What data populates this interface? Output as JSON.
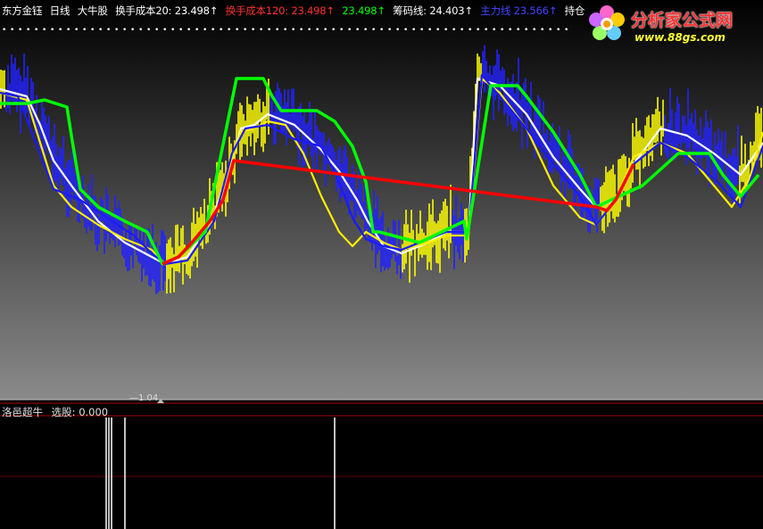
{
  "header": {
    "stock_name": "东方金钰",
    "period": "日线",
    "formula": "大牛股",
    "cost20_label": "换手成本20:",
    "cost20_value": "23.498",
    "cost120_label": "换手成本120:",
    "cost120_value": "23.498",
    "green_value": "23.498",
    "chip_label": "筹码线:",
    "chip_value": "24.403",
    "blue_label": "主力线",
    "blue_value": "23.566",
    "hold_label": "持仓"
  },
  "low_marker": "1.04",
  "sub_header": {
    "indicator_name": "洛邑超牛",
    "select_label": "选股:",
    "select_value": "0.000"
  },
  "logo": {
    "title": "分析家公式网",
    "url": "www.88gs.com"
  },
  "colors": {
    "background": "#000000",
    "gradient_bottom": "#8a8a8a",
    "price_yellow": "#ffff00",
    "price_blue": "#2222ff",
    "line_white": "#ffffff",
    "line_yellow": "#ffee00",
    "line_blue": "#1a1aff",
    "line_green": "#00ff00",
    "line_red": "#ff0000",
    "divider": "#aa0000"
  },
  "chart_data": [
    {
      "type": "line",
      "panel": "main",
      "y_scale": "price",
      "series": [
        {
          "color": "#ffffff",
          "points": [
            [
              0,
              0.15
            ],
            [
              30,
              0.17
            ],
            [
              45,
              0.25
            ],
            [
              60,
              0.35
            ],
            [
              80,
              0.42
            ],
            [
              110,
              0.52
            ],
            [
              140,
              0.58
            ],
            [
              170,
              0.62
            ],
            [
              185,
              0.64
            ],
            [
              210,
              0.62
            ],
            [
              240,
              0.5
            ],
            [
              260,
              0.35
            ],
            [
              270,
              0.26
            ],
            [
              285,
              0.25
            ],
            [
              300,
              0.22
            ],
            [
              330,
              0.25
            ],
            [
              360,
              0.32
            ],
            [
              380,
              0.38
            ],
            [
              400,
              0.46
            ],
            [
              412,
              0.52
            ],
            [
              430,
              0.59
            ],
            [
              450,
              0.61
            ],
            [
              480,
              0.58
            ],
            [
              500,
              0.55
            ],
            [
              520,
              0.55
            ],
            [
              525,
              0.55
            ],
            [
              535,
              0.12
            ],
            [
              560,
              0.14
            ],
            [
              590,
              0.22
            ],
            [
              620,
              0.34
            ],
            [
              650,
              0.43
            ],
            [
              668,
              0.48
            ],
            [
              690,
              0.46
            ],
            [
              710,
              0.36
            ],
            [
              740,
              0.26
            ],
            [
              770,
              0.28
            ],
            [
              800,
              0.33
            ],
            [
              830,
              0.39
            ],
            [
              855,
              0.3
            ]
          ]
        },
        {
          "color": "#ffee00",
          "points": [
            [
              0,
              0.16
            ],
            [
              30,
              0.18
            ],
            [
              45,
              0.3
            ],
            [
              60,
              0.42
            ],
            [
              80,
              0.48
            ],
            [
              110,
              0.53
            ],
            [
              140,
              0.57
            ],
            [
              170,
              0.6
            ],
            [
              185,
              0.64
            ],
            [
              210,
              0.63
            ],
            [
              240,
              0.52
            ],
            [
              260,
              0.35
            ],
            [
              270,
              0.27
            ],
            [
              285,
              0.26
            ],
            [
              300,
              0.24
            ],
            [
              320,
              0.25
            ],
            [
              340,
              0.33
            ],
            [
              360,
              0.45
            ],
            [
              380,
              0.55
            ],
            [
              395,
              0.59
            ],
            [
              410,
              0.55
            ],
            [
              430,
              0.58
            ],
            [
              450,
              0.6
            ],
            [
              480,
              0.58
            ],
            [
              500,
              0.56
            ],
            [
              520,
              0.56
            ],
            [
              525,
              0.56
            ],
            [
              540,
              0.12
            ],
            [
              560,
              0.16
            ],
            [
              590,
              0.26
            ],
            [
              620,
              0.42
            ],
            [
              650,
              0.51
            ],
            [
              668,
              0.53
            ],
            [
              690,
              0.46
            ],
            [
              710,
              0.34
            ],
            [
              740,
              0.3
            ],
            [
              770,
              0.33
            ],
            [
              800,
              0.42
            ],
            [
              820,
              0.48
            ],
            [
              840,
              0.4
            ],
            [
              855,
              0.27
            ]
          ]
        },
        {
          "color": "#1a1aff",
          "points": [
            [
              0,
              0.16
            ],
            [
              20,
              0.17
            ],
            [
              40,
              0.3
            ],
            [
              60,
              0.43
            ],
            [
              90,
              0.46
            ],
            [
              120,
              0.51
            ],
            [
              150,
              0.56
            ],
            [
              170,
              0.61
            ],
            [
              185,
              0.64
            ],
            [
              210,
              0.63
            ],
            [
              240,
              0.52
            ],
            [
              260,
              0.33
            ],
            [
              275,
              0.26
            ],
            [
              300,
              0.25
            ],
            [
              330,
              0.29
            ],
            [
              360,
              0.31
            ],
            [
              380,
              0.41
            ],
            [
              395,
              0.51
            ],
            [
              410,
              0.57
            ],
            [
              430,
              0.59
            ],
            [
              450,
              0.6
            ],
            [
              480,
              0.57
            ],
            [
              500,
              0.55
            ],
            [
              520,
              0.55
            ],
            [
              525,
              0.55
            ],
            [
              540,
              0.11
            ],
            [
              560,
              0.17
            ],
            [
              590,
              0.26
            ],
            [
              620,
              0.36
            ],
            [
              650,
              0.45
            ],
            [
              668,
              0.53
            ],
            [
              690,
              0.46
            ],
            [
              710,
              0.36
            ],
            [
              740,
              0.3
            ],
            [
              770,
              0.34
            ],
            [
              800,
              0.4
            ],
            [
              830,
              0.48
            ],
            [
              855,
              0.31
            ]
          ]
        },
        {
          "color": "#00ff00",
          "points": [
            [
              0,
              0.19
            ],
            [
              30,
              0.19
            ],
            [
              50,
              0.18
            ],
            [
              75,
              0.2
            ],
            [
              80,
              0.28
            ],
            [
              90,
              0.43
            ],
            [
              110,
              0.48
            ],
            [
              140,
              0.52
            ],
            [
              165,
              0.55
            ],
            [
              182,
              0.64
            ],
            [
              200,
              0.62
            ],
            [
              230,
              0.55
            ],
            [
              265,
              0.12
            ],
            [
              295,
              0.12
            ],
            [
              305,
              0.17
            ],
            [
              315,
              0.21
            ],
            [
              355,
              0.21
            ],
            [
              375,
              0.24
            ],
            [
              395,
              0.31
            ],
            [
              410,
              0.41
            ],
            [
              418,
              0.55
            ],
            [
              425,
              0.55
            ],
            [
              470,
              0.58
            ],
            [
              520,
              0.52
            ],
            [
              523,
              0.57
            ],
            [
              550,
              0.14
            ],
            [
              580,
              0.14
            ],
            [
              590,
              0.17
            ],
            [
              620,
              0.27
            ],
            [
              650,
              0.39
            ],
            [
              668,
              0.48
            ],
            [
              720,
              0.42
            ],
            [
              760,
              0.33
            ],
            [
              795,
              0.33
            ],
            [
              810,
              0.39
            ],
            [
              830,
              0.45
            ],
            [
              850,
              0.39
            ]
          ]
        },
        {
          "color": "#ff0000",
          "points": [
            [
              182,
              0.64
            ],
            [
              200,
              0.62
            ],
            [
              215,
              0.58
            ],
            [
              235,
              0.52
            ],
            [
              250,
              0.46
            ],
            [
              262,
              0.35
            ],
            [
              668,
              0.48
            ],
            [
              680,
              0.49
            ],
            [
              690,
              0.46
            ],
            [
              700,
              0.41
            ],
            [
              710,
              0.36
            ]
          ]
        }
      ]
    },
    {
      "type": "bar",
      "panel": "sub",
      "name": "选股",
      "ylim": [
        0,
        1
      ],
      "signals_x": [
        119,
        122,
        125,
        140,
        375
      ]
    }
  ]
}
